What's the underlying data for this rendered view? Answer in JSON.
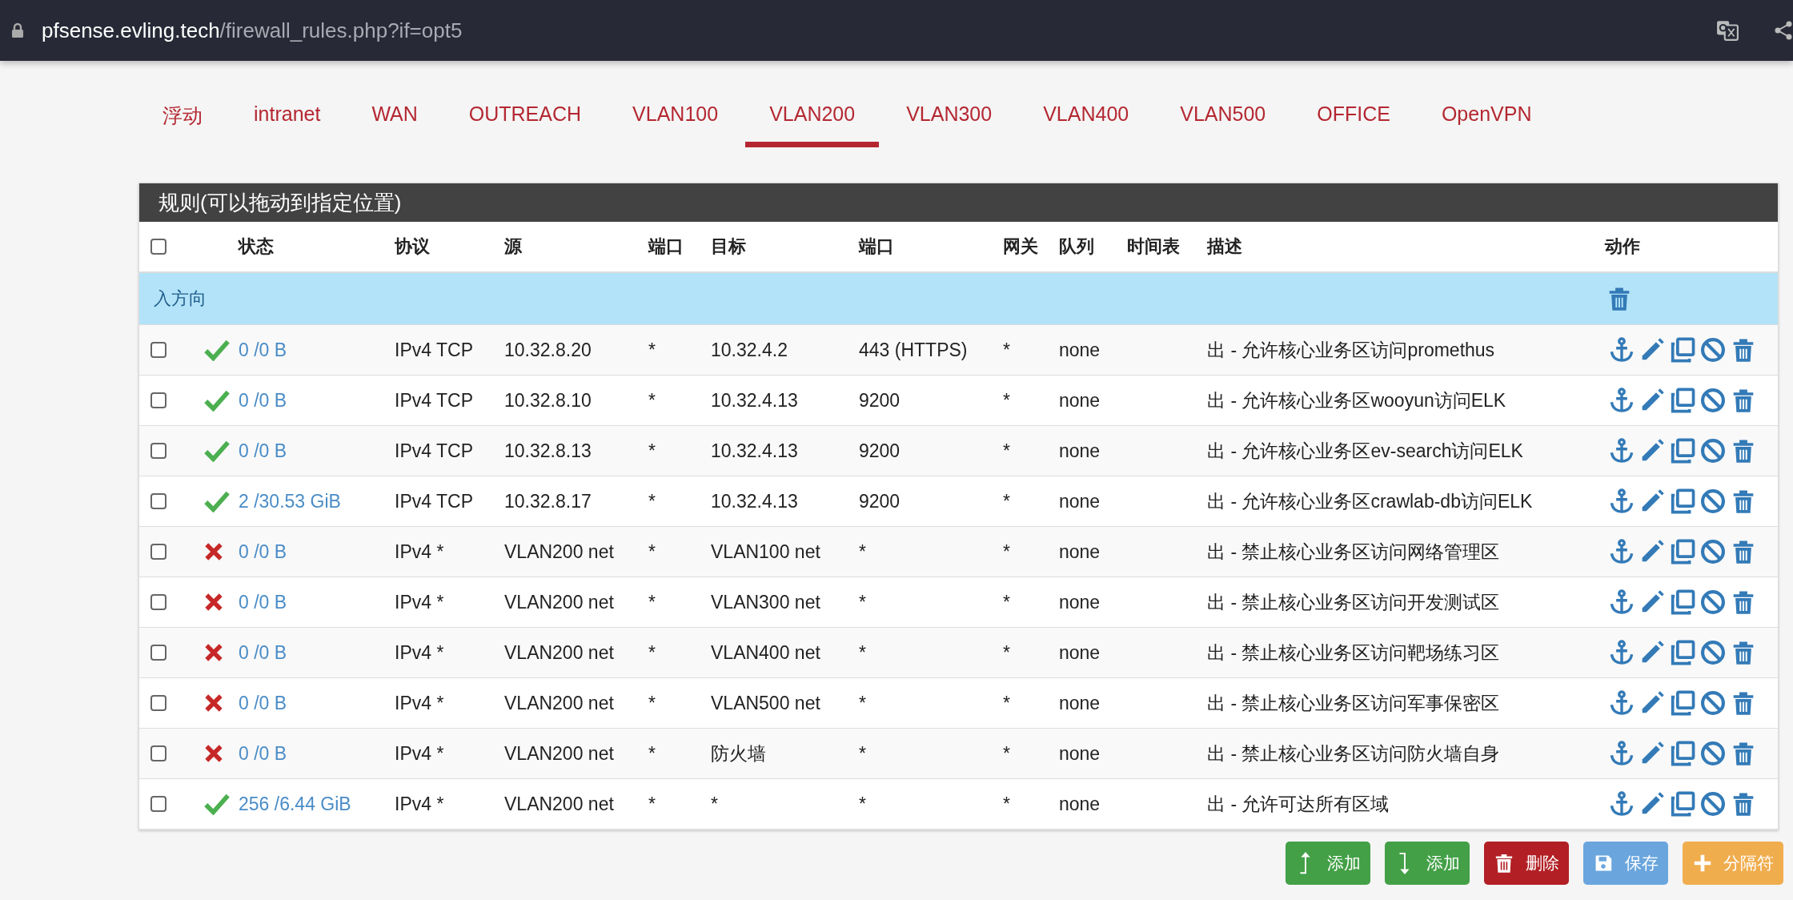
{
  "address_bar": {
    "host": "pfsense.evling.tech",
    "path": "/firewall_rules.php?if=opt5"
  },
  "tabs": [
    {
      "label": "浮动",
      "selected": false
    },
    {
      "label": "intranet",
      "selected": false
    },
    {
      "label": "WAN",
      "selected": false
    },
    {
      "label": "OUTREACH",
      "selected": false
    },
    {
      "label": "VLAN100",
      "selected": false
    },
    {
      "label": "VLAN200",
      "selected": true
    },
    {
      "label": "VLAN300",
      "selected": false
    },
    {
      "label": "VLAN400",
      "selected": false
    },
    {
      "label": "VLAN500",
      "selected": false
    },
    {
      "label": "OFFICE",
      "selected": false
    },
    {
      "label": "OpenVPN",
      "selected": false
    }
  ],
  "panel": {
    "title": "规则(可以拖动到指定位置)"
  },
  "table": {
    "select_all": {
      "checked": false
    },
    "columns": [
      "状态",
      "协议",
      "源",
      "端口",
      "目标",
      "端口",
      "网关",
      "队列",
      "时间表",
      "描述",
      "动作"
    ],
    "section": {
      "label": "入方向"
    },
    "rows": [
      {
        "checked": false,
        "kind": "pass",
        "states": "0 /0 B",
        "protocol": "IPv4 TCP",
        "source": "10.32.8.20",
        "source_port": "*",
        "destination": "10.32.4.2",
        "destination_port": "443 (HTTPS)",
        "gateway": "*",
        "queue": "none",
        "description": "出 - 允许核心业务区访问promethus"
      },
      {
        "checked": false,
        "kind": "pass",
        "states": "0 /0 B",
        "protocol": "IPv4 TCP",
        "source": "10.32.8.10",
        "source_port": "*",
        "destination": "10.32.4.13",
        "destination_port": "9200",
        "gateway": "*",
        "queue": "none",
        "description": "出 - 允许核心业务区wooyun访问ELK"
      },
      {
        "checked": false,
        "kind": "pass",
        "states": "0 /0 B",
        "protocol": "IPv4 TCP",
        "source": "10.32.8.13",
        "source_port": "*",
        "destination": "10.32.4.13",
        "destination_port": "9200",
        "gateway": "*",
        "queue": "none",
        "description": "出 - 允许核心业务区ev-search访问ELK"
      },
      {
        "checked": false,
        "kind": "pass",
        "states": "2 /30.53 GiB",
        "protocol": "IPv4 TCP",
        "source": "10.32.8.17",
        "source_port": "*",
        "destination": "10.32.4.13",
        "destination_port": "9200",
        "gateway": "*",
        "queue": "none",
        "description": "出 - 允许核心业务区crawlab-db访问ELK"
      },
      {
        "checked": false,
        "kind": "block",
        "states": "0 /0 B",
        "protocol": "IPv4 *",
        "source": "VLAN200 net",
        "source_port": "*",
        "destination": "VLAN100 net",
        "destination_port": "*",
        "gateway": "*",
        "queue": "none",
        "description": "出 - 禁止核心业务区访问网络管理区"
      },
      {
        "checked": false,
        "kind": "block",
        "states": "0 /0 B",
        "protocol": "IPv4 *",
        "source": "VLAN200 net",
        "source_port": "*",
        "destination": "VLAN300 net",
        "destination_port": "*",
        "gateway": "*",
        "queue": "none",
        "description": "出 - 禁止核心业务区访问开发测试区"
      },
      {
        "checked": false,
        "kind": "block",
        "states": "0 /0 B",
        "protocol": "IPv4 *",
        "source": "VLAN200 net",
        "source_port": "*",
        "destination": "VLAN400 net",
        "destination_port": "*",
        "gateway": "*",
        "queue": "none",
        "description": "出 - 禁止核心业务区访问靶场练习区"
      },
      {
        "checked": false,
        "kind": "block",
        "states": "0 /0 B",
        "protocol": "IPv4 *",
        "source": "VLAN200 net",
        "source_port": "*",
        "destination": "VLAN500 net",
        "destination_port": "*",
        "gateway": "*",
        "queue": "none",
        "description": "出 - 禁止核心业务区访问军事保密区"
      },
      {
        "checked": false,
        "kind": "block",
        "states": "0 /0 B",
        "protocol": "IPv4 *",
        "source": "VLAN200 net",
        "source_port": "*",
        "destination": "防火墙",
        "destination_port": "*",
        "gateway": "*",
        "queue": "none",
        "description": "出 - 禁止核心业务区访问防火墙自身"
      },
      {
        "checked": false,
        "kind": "pass",
        "states": "256 /6.44 GiB",
        "protocol": "IPv4 *",
        "source": "VLAN200 net",
        "source_port": "*",
        "destination": "*",
        "destination_port": "*",
        "gateway": "*",
        "queue": "none",
        "description": "出 - 允许可达所有区域"
      }
    ]
  },
  "buttons": [
    {
      "kind": "add-top",
      "label": "添加"
    },
    {
      "kind": "add-bottom",
      "label": "添加"
    },
    {
      "kind": "delete",
      "label": "删除"
    },
    {
      "kind": "save",
      "label": "保存"
    },
    {
      "kind": "separator",
      "label": "分隔符"
    }
  ]
}
